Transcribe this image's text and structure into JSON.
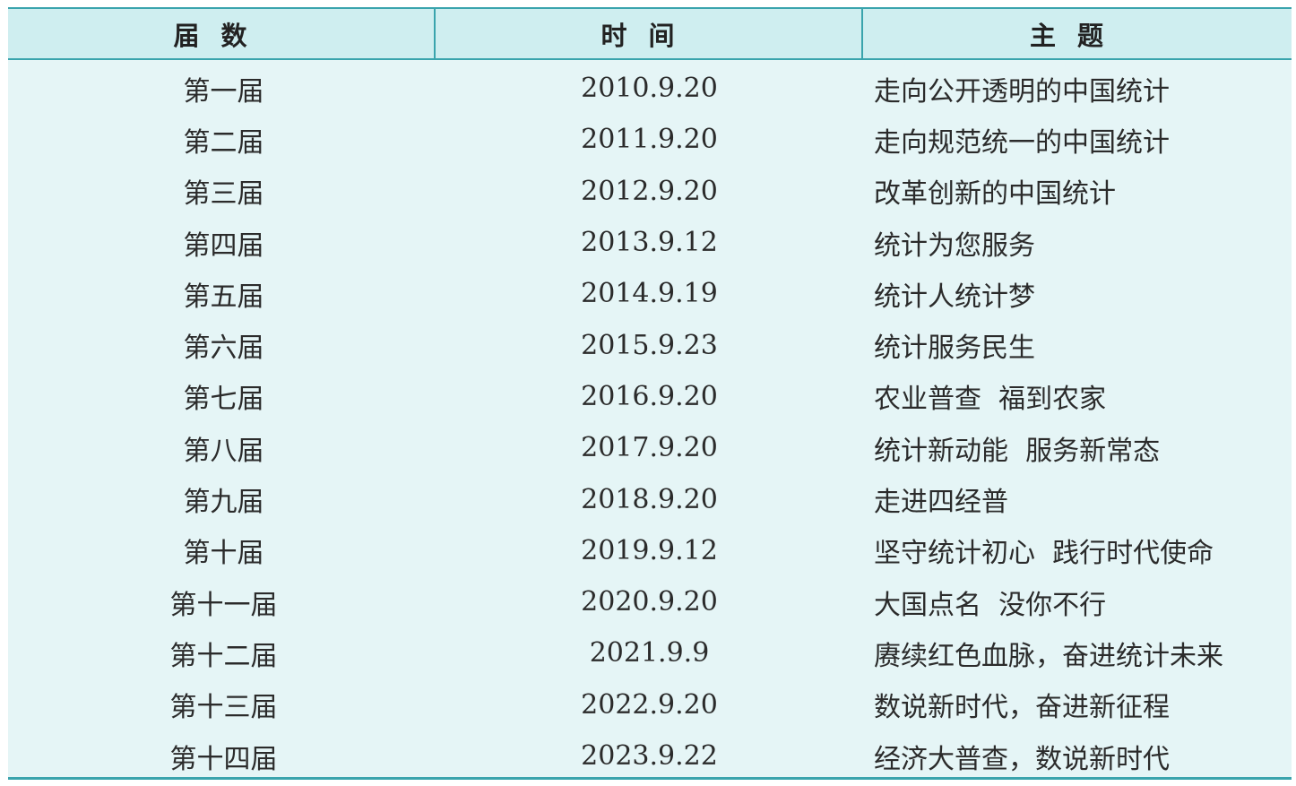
{
  "table": {
    "headers": [
      "届数",
      "时间",
      "主题"
    ],
    "rows": [
      {
        "session": "第一届",
        "date": "2010.9.20",
        "theme": "走向公开透明的中国统计"
      },
      {
        "session": "第二届",
        "date": "2011.9.20",
        "theme": "走向规范统一的中国统计"
      },
      {
        "session": "第三届",
        "date": "2012.9.20",
        "theme": "改革创新的中国统计"
      },
      {
        "session": "第四届",
        "date": "2013.9.12",
        "theme": "统计为您服务"
      },
      {
        "session": "第五届",
        "date": "2014.9.19",
        "theme": "统计人统计梦"
      },
      {
        "session": "第六届",
        "date": "2015.9.23",
        "theme": "统计服务民生"
      },
      {
        "session": "第七届",
        "date": "2016.9.20",
        "theme": "农业普查  福到农家"
      },
      {
        "session": "第八届",
        "date": "2017.9.20",
        "theme": "统计新动能  服务新常态"
      },
      {
        "session": "第九届",
        "date": "2018.9.20",
        "theme": "走进四经普"
      },
      {
        "session": "第十届",
        "date": "2019.9.12",
        "theme": "坚守统计初心  践行时代使命"
      },
      {
        "session": "第十一届",
        "date": "2020.9.20",
        "theme": "大国点名  没你不行"
      },
      {
        "session": "第十二届",
        "date": "2021.9.9",
        "theme": "赓续红色血脉，奋进统计未来"
      },
      {
        "session": "第十三届",
        "date": "2022.9.20",
        "theme": "数说新时代，奋进新征程"
      },
      {
        "session": "第十四届",
        "date": "2023.9.22",
        "theme": "经济大普查，数说新时代"
      }
    ]
  },
  "colors": {
    "rule": "#3aa4ad",
    "header_bg": "#cfeef0",
    "body_bg": "#e5f5f6"
  }
}
